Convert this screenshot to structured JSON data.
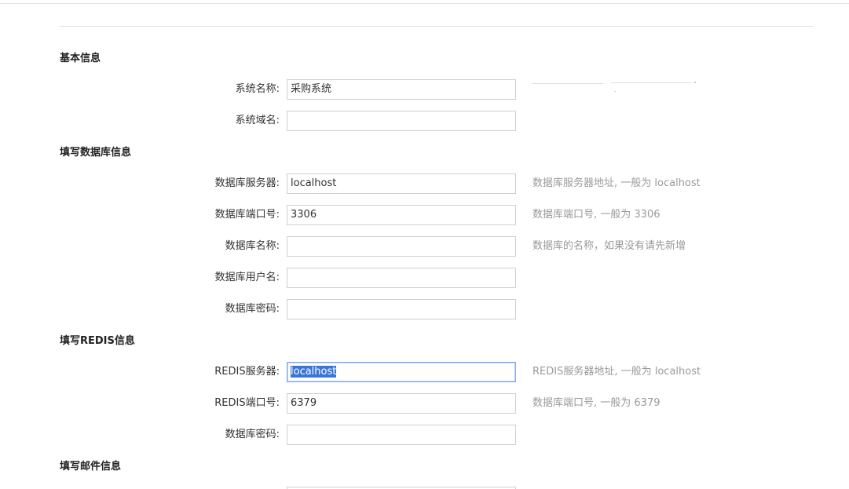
{
  "sections": {
    "basic": {
      "title": "基本信息"
    },
    "database": {
      "title": "填写数据库信息"
    },
    "redis": {
      "title": "填写REDIS信息"
    },
    "mail": {
      "title": "填写邮件信息"
    }
  },
  "basic": {
    "system_name": {
      "label": "系统名称:",
      "value": "采购系统"
    },
    "system_domain": {
      "label": "系统域名:",
      "value": ""
    }
  },
  "database": {
    "server": {
      "label": "数据库服务器:",
      "value": "localhost",
      "hint": "数据库服务器地址, 一般为 localhost"
    },
    "port": {
      "label": "数据库端口号:",
      "value": "3306",
      "hint": "数据库端口号, 一般为 3306"
    },
    "name": {
      "label": "数据库名称:",
      "value": "",
      "hint": "数据库的名称，如果没有请先新增"
    },
    "user": {
      "label": "数据库用户名:",
      "value": ""
    },
    "password": {
      "label": "数据库密码:",
      "value": ""
    }
  },
  "redis": {
    "server": {
      "label": "REDIS服务器:",
      "value": "localhost",
      "hint": "REDIS服务器地址, 一般为 localhost"
    },
    "port": {
      "label": "REDIS端口号:",
      "value": "6379",
      "hint": "数据库端口号, 一般为 6379"
    },
    "password": {
      "label": "数据库密码:",
      "value": ""
    }
  },
  "colors": {
    "selection": "#3a75d8",
    "focus_border": "#7fa7e6",
    "hint_text": "#9a9a9a"
  }
}
